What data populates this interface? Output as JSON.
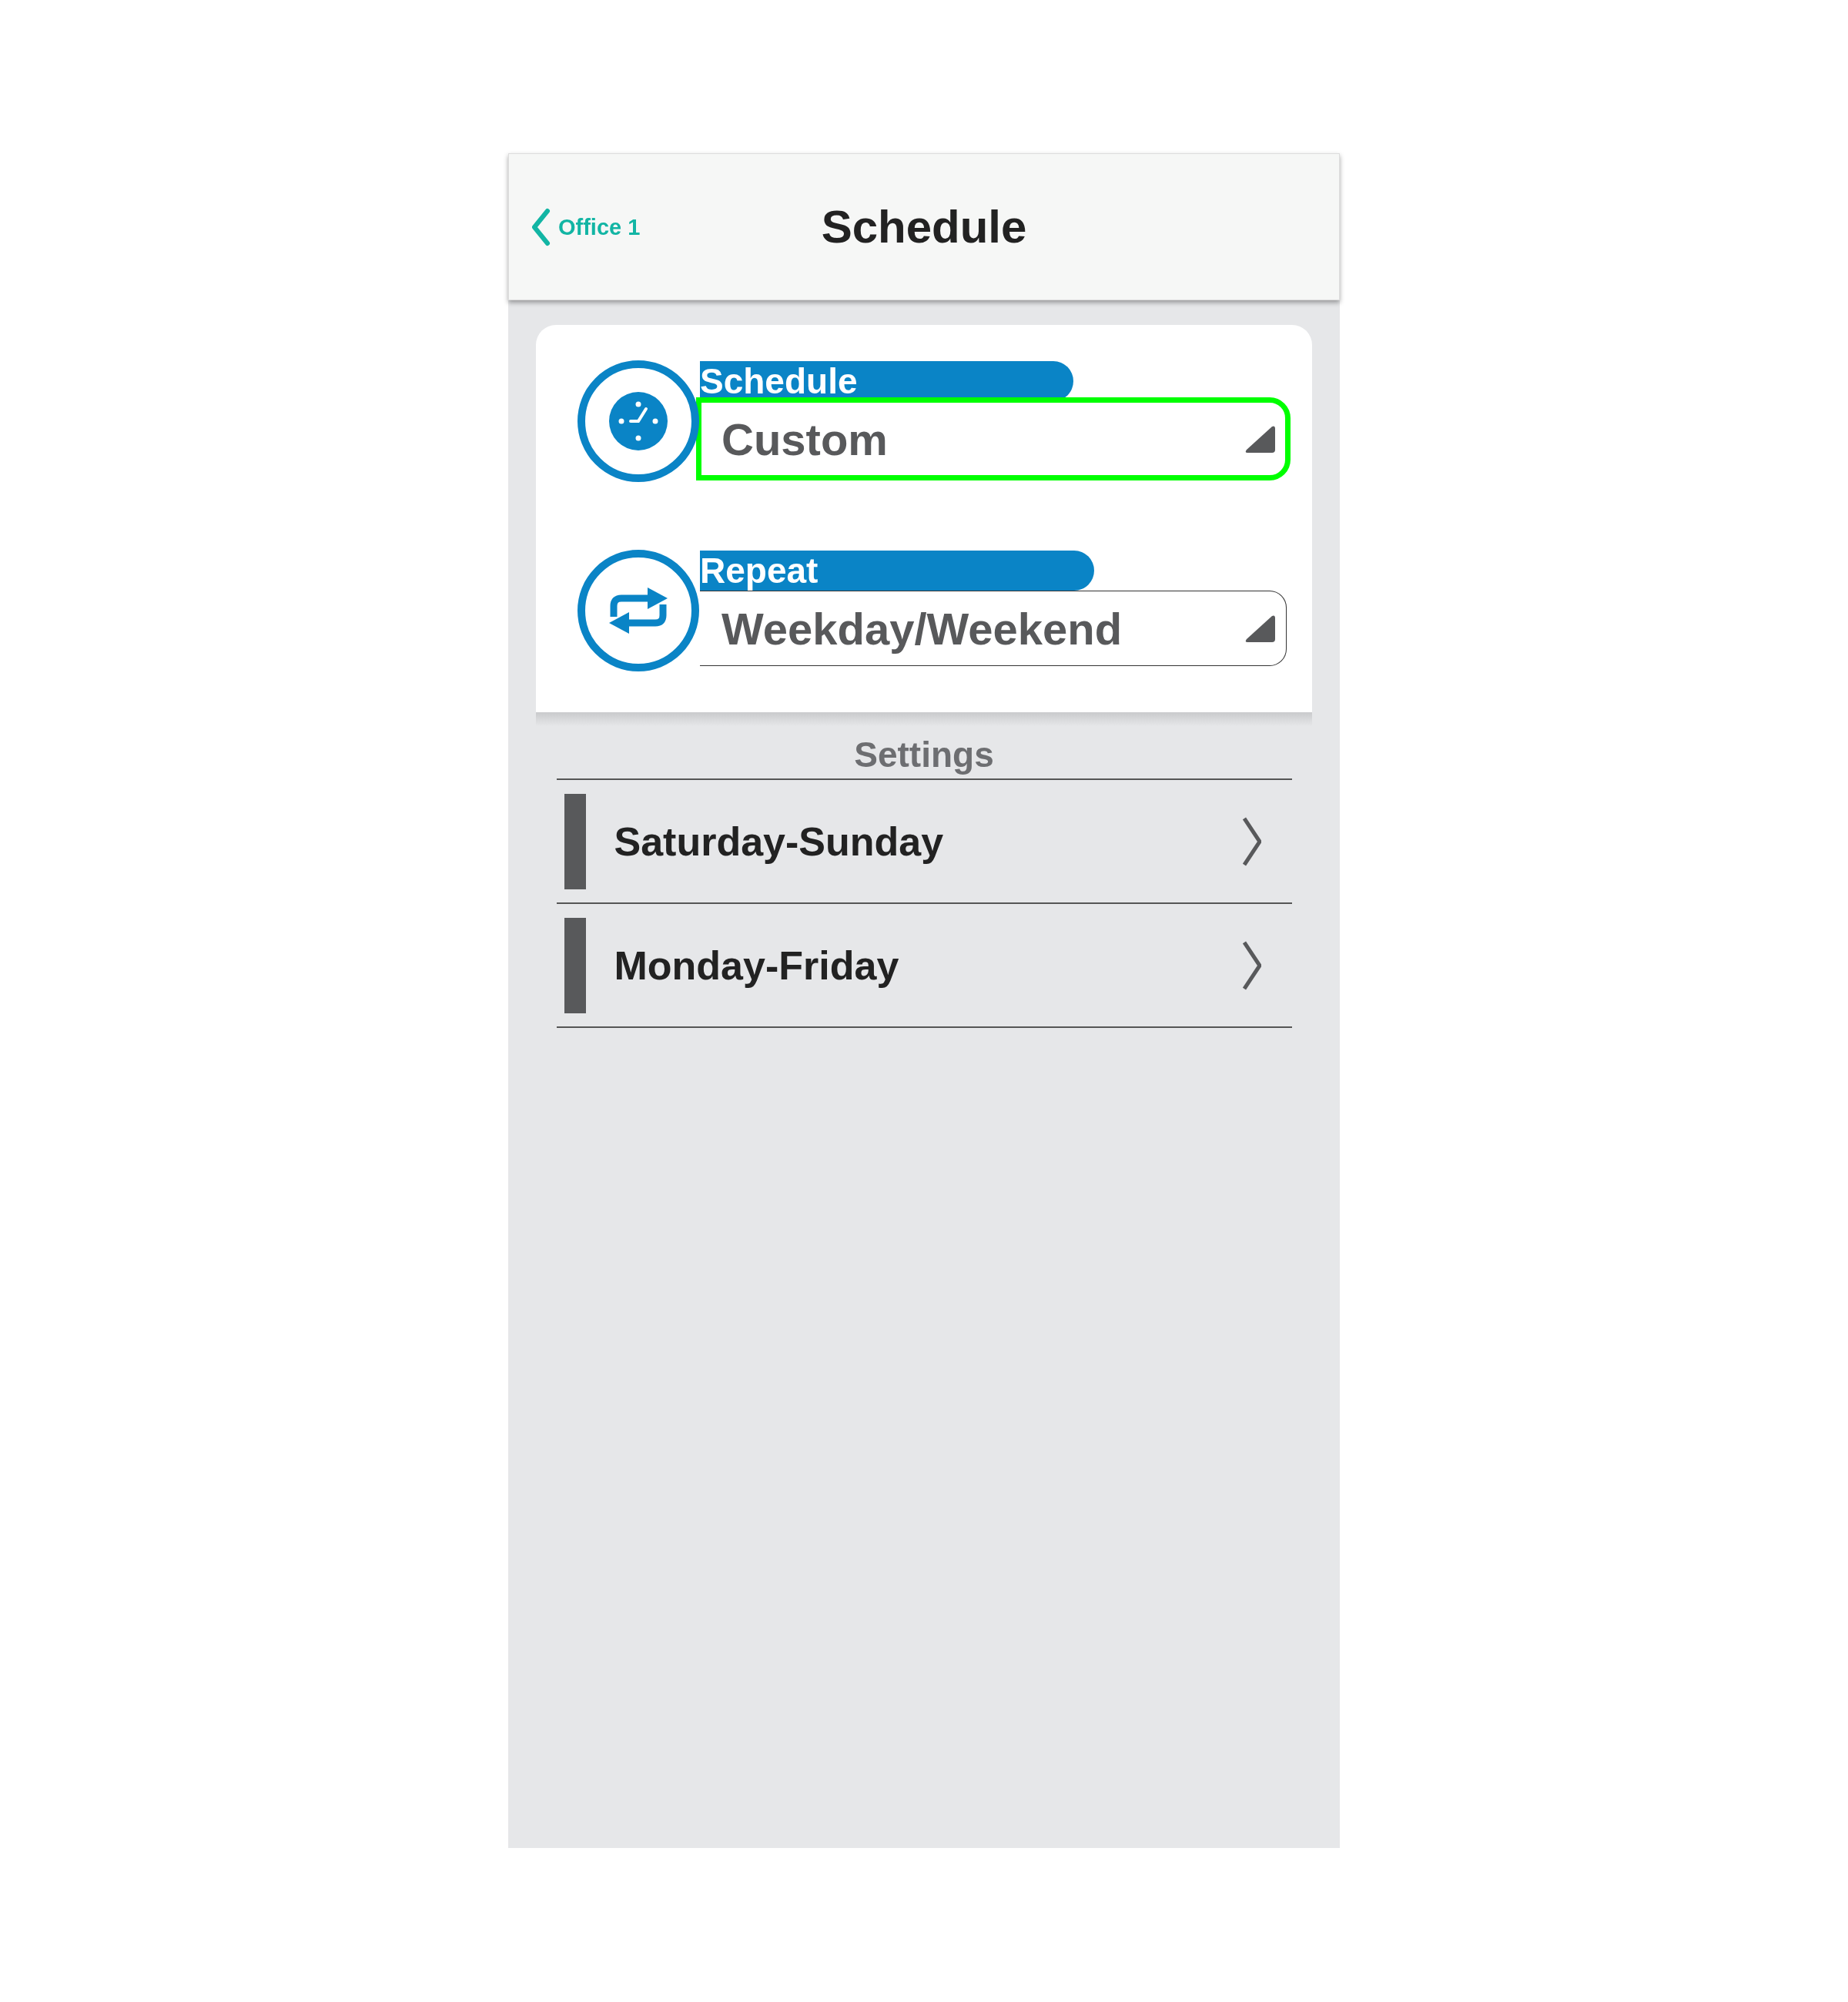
{
  "header": {
    "back_label": "Office 1",
    "title": "Schedule"
  },
  "fields": [
    {
      "kind": "schedule",
      "label": "Schedule",
      "value": "Custom",
      "highlighted": true
    },
    {
      "kind": "repeat",
      "label": "Repeat",
      "value": "Weekday/Weekend",
      "highlighted": false
    }
  ],
  "settings": {
    "title": "Settings",
    "items": [
      {
        "label": "Saturday-Sunday"
      },
      {
        "label": "Monday-Friday"
      }
    ]
  }
}
